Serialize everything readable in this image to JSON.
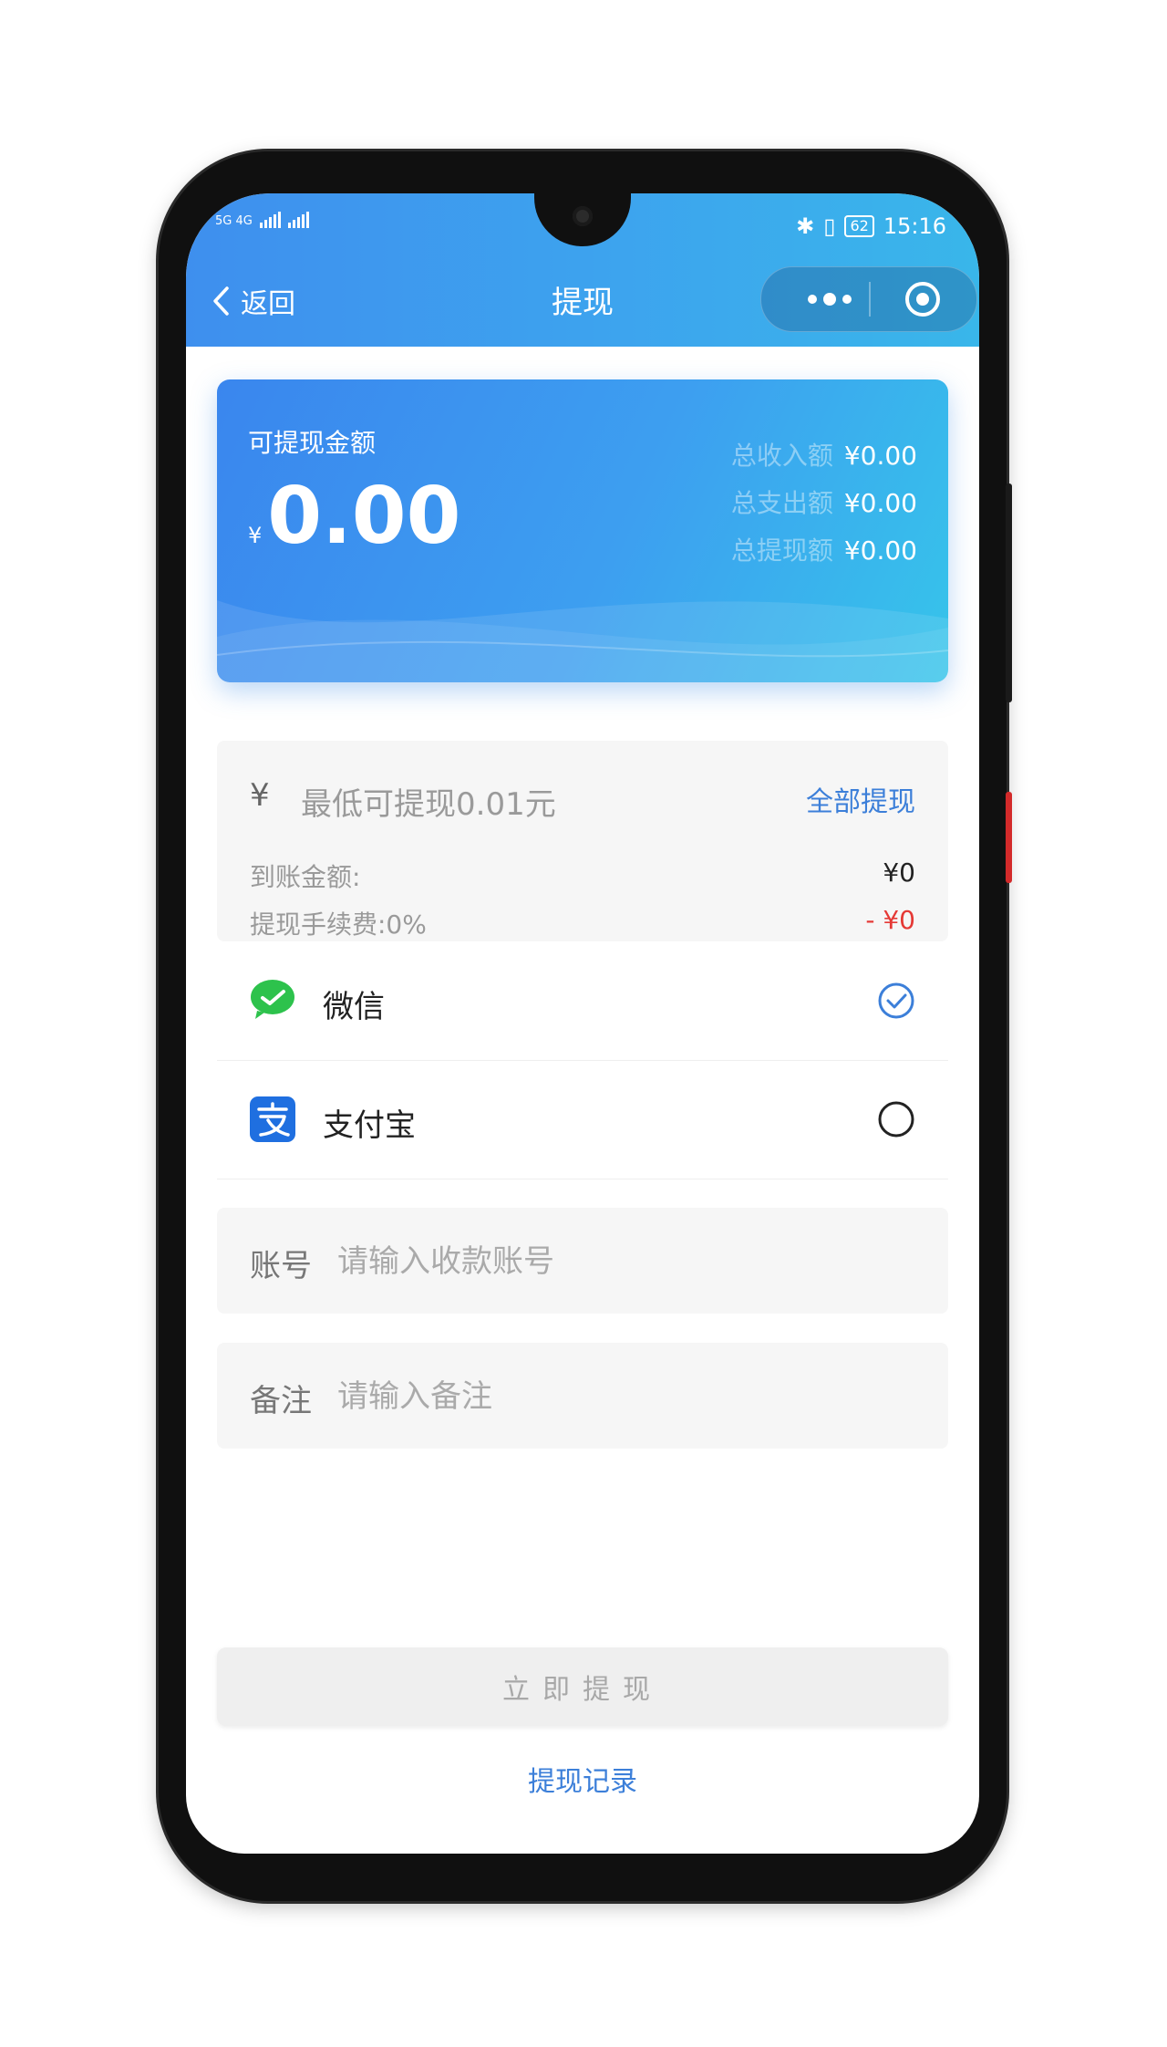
{
  "status_bar": {
    "network_left": "5G 4G",
    "time": "15:16",
    "battery": "62"
  },
  "nav": {
    "back_label": "返回",
    "title": "提现"
  },
  "balance": {
    "label": "可提现金额",
    "currency": "¥",
    "amount": "0.00",
    "stats": [
      {
        "label": "总收入额",
        "value": "¥0.00"
      },
      {
        "label": "总支出额",
        "value": "¥0.00"
      },
      {
        "label": "总提现额",
        "value": "¥0.00"
      }
    ]
  },
  "withdraw_amount": {
    "currency": "¥",
    "placeholder": "最低可提现0.01元",
    "withdraw_all": "全部提现",
    "arrival_label": "到账金额:",
    "arrival_value": "¥0",
    "fee_label": "提现手续费:0%",
    "fee_value": "- ¥0"
  },
  "payment_methods": [
    {
      "label": "微信",
      "selected": true,
      "icon": "wechat-icon"
    },
    {
      "label": "支付宝",
      "selected": false,
      "icon": "alipay-icon"
    }
  ],
  "account_field": {
    "label": "账号",
    "placeholder": "请输入收款账号"
  },
  "note_field": {
    "label": "备注",
    "placeholder": "请输入备注"
  },
  "submit_label": "立即提现",
  "records_link": "提现记录",
  "colors": {
    "accent": "#3c7fd9",
    "header_start": "#3e8fee",
    "header_end": "#39b6ea",
    "negative": "#e53935",
    "wechat": "#2dc24c",
    "alipay": "#1677ff"
  }
}
